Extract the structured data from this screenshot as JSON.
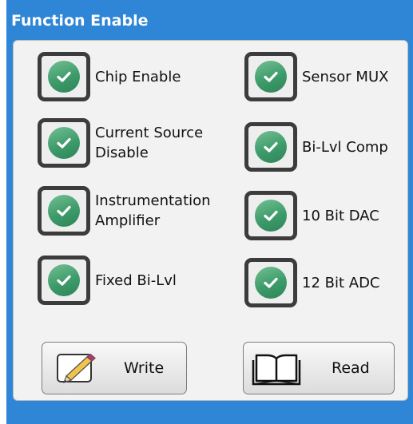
{
  "panel": {
    "title": "Function Enable"
  },
  "checkboxes": [
    {
      "label": "Chip Enable",
      "checked": true
    },
    {
      "label": "Sensor MUX",
      "checked": true
    },
    {
      "label": "Current Source\nDisable",
      "checked": true
    },
    {
      "label": "Bi-Lvl Comp",
      "checked": true
    },
    {
      "label": "Instrumentation\nAmplifier",
      "checked": true
    },
    {
      "label": "10 Bit DAC",
      "checked": true
    },
    {
      "label": "Fixed Bi-Lvl",
      "checked": true
    },
    {
      "label": "12 Bit ADC",
      "checked": true
    }
  ],
  "buttons": {
    "write_label": "Write",
    "write_icon": "pencil-icon",
    "read_label": "Read",
    "read_icon": "open-book-icon"
  },
  "colors": {
    "panel_header": "#2f86d6",
    "check_green": "#3d9b6a"
  }
}
